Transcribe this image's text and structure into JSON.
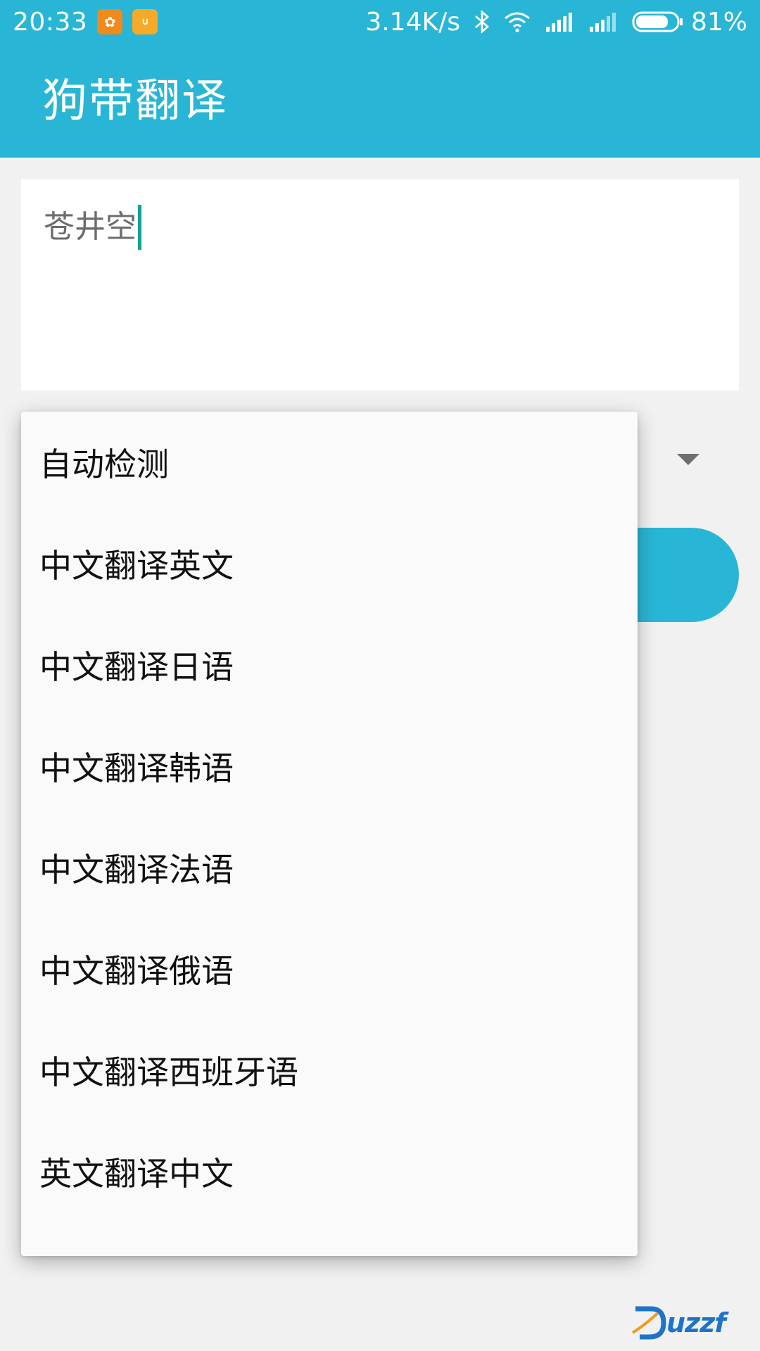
{
  "status_bar": {
    "time": "20:33",
    "net_speed": "3.14K/s",
    "battery_percent": "81%",
    "battery_level": 0.81,
    "icons": [
      "uc-browser-icon",
      "mi-store-icon",
      "bluetooth-icon",
      "wifi-icon",
      "signal-icon",
      "battery-icon"
    ]
  },
  "app_bar": {
    "title": "狗带翻译"
  },
  "input": {
    "value": "苍井空"
  },
  "dropdown": {
    "options": [
      "自动检测",
      "中文翻译英文",
      "中文翻译日语",
      "中文翻译韩语",
      "中文翻译法语",
      "中文翻译俄语",
      "中文翻译西班牙语",
      "英文翻译中文"
    ]
  },
  "colors": {
    "primary": "#29b6d6",
    "accent_caret": "#11a296",
    "popup_bg": "#fafafa"
  }
}
